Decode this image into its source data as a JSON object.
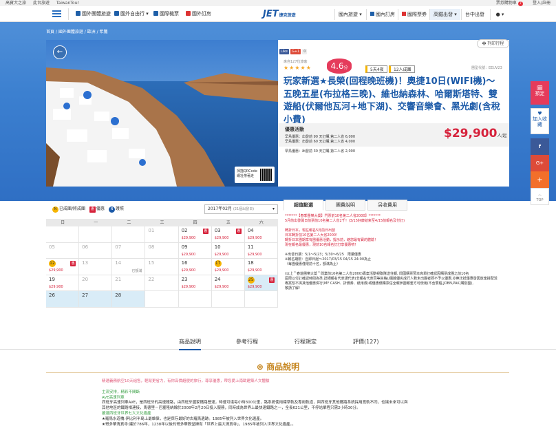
{
  "topbar": {
    "links": [
      "高寶大之旅",
      "此台旅遊",
      "TaiwanTour"
    ],
    "cart": "票券購物車",
    "cart_count": "7",
    "login": "登入/註冊"
  },
  "nav": {
    "items": [
      "國外團體旅遊",
      "國外自由行",
      "國際機票",
      "國外訂房"
    ],
    "logo": "JET",
    "logo_sub": "捷克旅遊",
    "right": [
      "國內旅遊",
      "國內訂房",
      "國際票券",
      "高鐵出發",
      "台中出發"
    ]
  },
  "breadcrumb": "首頁 / 國外團體旅遊 / 歐洲 / 希臘",
  "qr": {
    "line1": "掃描QRCode",
    "line2": "網址帶著走"
  },
  "share": [
    "Like",
    "G+1",
    "0"
  ],
  "print": "列印行程",
  "rating": {
    "label": "來自127位旅客",
    "score": "4.6",
    "unit": "分"
  },
  "tags": [
    "5天4夜",
    "12人成團"
  ],
  "prodno": "團型代號：EEUV23",
  "title": "玩家新選★長榮(回程晚班機)！奧捷10日(WIFI機)～五晚五星(布拉格三晚)、維也納森林、哈爾斯塔特、雙遊船(伏爾他瓦河+地下湖)、交響音樂會、黑光劇(含稅小費)",
  "promo": {
    "heading": "優惠活動",
    "lines": [
      "早鳥優惠：出發前 90 天訂購,第二人省 6,000",
      "早鳥優惠：出發前 60 天訂購,第二人省 4,000",
      "早鳥優惠：出發前 30 天訂購,第二人省 2,000"
    ]
  },
  "price": "$29,900",
  "price_unit": "人/起",
  "side": {
    "book": "預定",
    "fav": "加入收藏",
    "top": "TOP"
  },
  "legend": [
    {
      "ic": "N",
      "label": "已成團/將成團"
    },
    {
      "ic": "惠",
      "label": "優惠"
    },
    {
      "ic": "N",
      "label": "護照"
    }
  ],
  "month": "2017年02月",
  "month_note": "(21個出發日)",
  "weekdays": [
    "日",
    "一",
    "二",
    "三",
    "四",
    "五",
    "六"
  ],
  "cal": [
    [
      {
        "d": "",
        "t": "b"
      },
      {
        "d": "",
        "t": "b"
      },
      {
        "d": "",
        "t": "b"
      },
      {
        "d": "01",
        "t": "past"
      },
      {
        "d": "02",
        "p": "$29,900",
        "g": 1
      },
      {
        "d": "03",
        "p": "$29,900",
        "g": 1
      },
      {
        "d": "04",
        "p": "$29,900"
      }
    ],
    [
      {
        "d": "05",
        "t": "past"
      },
      {
        "d": "06",
        "t": "past"
      },
      {
        "d": "07",
        "t": "past"
      },
      {
        "d": "08",
        "t": "past"
      },
      {
        "d": "09",
        "p": "$29,900"
      },
      {
        "d": "10",
        "p": "$29,900"
      },
      {
        "d": "11",
        "p": "$29,900"
      }
    ],
    [
      {
        "d": "12",
        "o": 1,
        "p": "$29,900",
        "g": 1
      },
      {
        "d": "13",
        "t": "past"
      },
      {
        "d": "14",
        "t": "past",
        "full": "已額滿"
      },
      {
        "d": "15",
        "t": "past"
      },
      {
        "d": "16",
        "p": "$29,900"
      },
      {
        "d": "17",
        "o": 1,
        "p": "$29,900"
      },
      {
        "d": "18",
        "p": "$29,900"
      }
    ],
    [
      {
        "d": "19",
        "p": "$29,900"
      },
      {
        "d": "20",
        "t": "past"
      },
      {
        "d": "21",
        "t": "past"
      },
      {
        "d": "22",
        "t": "past"
      },
      {
        "d": "23",
        "p": "$29,900"
      },
      {
        "d": "24",
        "p": "$29,900"
      },
      {
        "d": "25",
        "o": 1,
        "p": "$29,900",
        "g": 1,
        "hl": 1
      }
    ],
    [
      {
        "d": "26",
        "hl": 1
      },
      {
        "d": "27",
        "hl": 1
      },
      {
        "d": "28",
        "hl": 1
      },
      {
        "d": "",
        "t": "b"
      },
      {
        "d": "",
        "t": "b"
      },
      {
        "d": "",
        "t": "b"
      },
      {
        "d": "",
        "t": "b"
      }
    ]
  ],
  "tabs": [
    "超值點選",
    "團費說明",
    "另收費用"
  ],
  "notes": [
    "*******【春季團樂大獎】門票前10名第二人省2000】*******",
    "5月前出發開日前票前10名第二人省2千！(3/15好康結束至4/15前報名及付訂)",
    "",
    "轉折日本，現在報名5月前日出發",
    "日本轉折前10名第二人大省2000！",
    "轉折日本團期享有團優惠活動，提示前，絡您最有寶的體驗！",
    "現在報名最優惠，現前10名報名訂訂享優惠唷！",
    "",
    "※出發日期：5/1～5/23；5/30～6/25　限量優惠",
    "※報名期限：自即日起～2017/03/15 04/15 24:00為止",
    "（每團優惠僅限前十名，額滿為止）",
    "",
    "(以上＂春遊團樂大獎＂問業前10名第二人省2000)專案活動視聯隊送住報, 問國購票預本高單訂確認因購票成團之前10名",
    "屆限以付訂確認時間為準,詳細報名代表請代表(非報名代表同等資格)/團體優劣成行人數未出團者即不予以優惠,亦無法抵優惠發因放棄搭配活",
    "專案恕不與其他優惠併行(MY CASH、折價券、紙用券)或優惠價購票信全報參團報套方可使用(不含雙程,JOBN,PAK,購別團),",
    "敬請了解!"
  ],
  "bottom_tabs": [
    "商品說明",
    "參考行程",
    "行程規定",
    "評價(127)"
  ],
  "section_title": "商品說明",
  "desc": {
    "pink": "精選義務航空10天組售，輕鬆更省力，有你高價超便的旅行，尊享優惠，帶您愛上南歐建築人文體驗",
    "green": [
      "主流安排，精彩不間斷",
      "AVE高速列車"
    ],
    "lines": [
      "西班牙高速列車AVE，是西班牙的高速鐵路，由西班牙國家鐵路營運，時速可達每小時300公里，路系統使用標準軌及專用軌道，與西班牙其他鐵路系統採用寬軌不同，也讓未來可以與",
      "其他地區的鐵路相連接，馬德里－巴塞隆納線於2008年2月20日投入服務，同時成為世界上最快速鐵路之一，全長621公里，不停站單程只需2小時30分。"
    ],
    "green2": "嚴選西班牙世界七大文化遺產",
    "lines2": [
      "★羅馬水道橋:伊比利半島上最雄偉，也是保存最好的古羅馬遺跡。1985年被列入世界文化遺產。",
      "★哥多華清真寺:建於786年，1238年以後的哥多華教堂擁有「世界上最大清真寺」，1985年被列入世界文化遺產。。"
    ]
  }
}
